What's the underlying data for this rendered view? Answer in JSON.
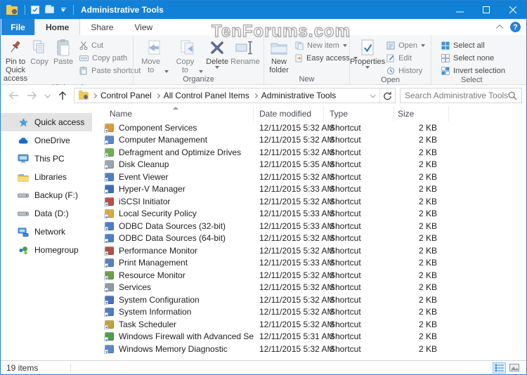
{
  "colors": {
    "titlebar": "#1081d7",
    "accent": "#2a7fd4",
    "file_tab": "#1f83d9",
    "sidebar_selected": "#e3e3e3"
  },
  "window": {
    "title": "Administrative Tools"
  },
  "watermark": "TenForums.com",
  "tabs": {
    "file": "File",
    "home": "Home",
    "share": "Share",
    "view": "View",
    "help_glyph": "?"
  },
  "ribbon": {
    "clipboard": {
      "label": "Clipboard",
      "pin": "Pin to Quick access",
      "copy": "Copy",
      "paste": "Paste",
      "cut": "Cut",
      "copy_path": "Copy path",
      "paste_shortcut": "Paste shortcut"
    },
    "organize": {
      "label": "Organize",
      "move_to": "Move to",
      "copy_to": "Copy to",
      "delete": "Delete",
      "rename": "Rename"
    },
    "new": {
      "label": "New",
      "new_folder": "New folder",
      "new_item": "New item",
      "easy_access": "Easy access"
    },
    "open": {
      "label": "Open",
      "properties": "Properties",
      "open": "Open",
      "edit": "Edit",
      "history": "History"
    },
    "select": {
      "label": "Select",
      "select_all": "Select all",
      "select_none": "Select none",
      "invert": "Invert selection"
    }
  },
  "addressbar": {
    "breadcrumbs": [
      "Control Panel",
      "All Control Panel Items",
      "Administrative Tools"
    ]
  },
  "search": {
    "placeholder": "Search Administrative Tools"
  },
  "sidebar": {
    "items": [
      {
        "label": "Quick access",
        "selected": true
      },
      {
        "label": "OneDrive"
      },
      {
        "label": "This PC"
      },
      {
        "label": "Libraries"
      },
      {
        "label": "Backup (F:)"
      },
      {
        "label": "Data (D:)"
      },
      {
        "label": "Network"
      },
      {
        "label": "Homegroup"
      }
    ]
  },
  "files": {
    "columns": [
      "Name",
      "Date modified",
      "Type",
      "Size"
    ],
    "rows": [
      {
        "name": "Component Services",
        "date": "12/11/2015 5:32 AM",
        "type": "Shortcut",
        "size": "2 KB",
        "color": "#d99a3a"
      },
      {
        "name": "Computer Management",
        "date": "12/11/2015 5:32 AM",
        "type": "Shortcut",
        "size": "2 KB",
        "color": "#5b87c5"
      },
      {
        "name": "Defragment and Optimize Drives",
        "date": "12/11/2015 5:32 AM",
        "type": "Shortcut",
        "size": "2 KB",
        "color": "#6faf4e"
      },
      {
        "name": "Disk Cleanup",
        "date": "12/11/2015 5:35 AM",
        "type": "Shortcut",
        "size": "2 KB",
        "color": "#98a4ae"
      },
      {
        "name": "Event Viewer",
        "date": "12/11/2015 5:32 AM",
        "type": "Shortcut",
        "size": "2 KB",
        "color": "#4c7fc0"
      },
      {
        "name": "Hyper-V Manager",
        "date": "12/11/2015 5:33 AM",
        "type": "Shortcut",
        "size": "2 KB",
        "color": "#3e6db3"
      },
      {
        "name": "iSCSI Initiator",
        "date": "12/11/2015 5:32 AM",
        "type": "Shortcut",
        "size": "2 KB",
        "color": "#b8524a"
      },
      {
        "name": "Local Security Policy",
        "date": "12/11/2015 5:33 AM",
        "type": "Shortcut",
        "size": "2 KB",
        "color": "#d8a93c"
      },
      {
        "name": "ODBC Data Sources (32-bit)",
        "date": "12/11/2015 5:33 AM",
        "type": "Shortcut",
        "size": "2 KB",
        "color": "#4d7ec2"
      },
      {
        "name": "ODBC Data Sources (64-bit)",
        "date": "12/11/2015 5:32 AM",
        "type": "Shortcut",
        "size": "2 KB",
        "color": "#4d7ec2"
      },
      {
        "name": "Performance Monitor",
        "date": "12/11/2015 5:32 AM",
        "type": "Shortcut",
        "size": "2 KB",
        "color": "#b05048"
      },
      {
        "name": "Print Management",
        "date": "12/11/2015 5:33 AM",
        "type": "Shortcut",
        "size": "2 KB",
        "color": "#5a7ec2"
      },
      {
        "name": "Resource Monitor",
        "date": "12/11/2015 5:32 AM",
        "type": "Shortcut",
        "size": "2 KB",
        "color": "#6e9e45"
      },
      {
        "name": "Services",
        "date": "12/11/2015 5:32 AM",
        "type": "Shortcut",
        "size": "2 KB",
        "color": "#8d9aa5"
      },
      {
        "name": "System Configuration",
        "date": "12/11/2015 5:32 AM",
        "type": "Shortcut",
        "size": "2 KB",
        "color": "#4d6fc0"
      },
      {
        "name": "System Information",
        "date": "12/11/2015 5:32 AM",
        "type": "Shortcut",
        "size": "2 KB",
        "color": "#4d7ec2"
      },
      {
        "name": "Task Scheduler",
        "date": "12/11/2015 5:32 AM",
        "type": "Shortcut",
        "size": "2 KB",
        "color": "#c2a23a"
      },
      {
        "name": "Windows Firewall with Advanced Security",
        "date": "12/11/2015 5:31 AM",
        "type": "Shortcut",
        "size": "2 KB",
        "color": "#4b9e4b"
      },
      {
        "name": "Windows Memory Diagnostic",
        "date": "12/11/2015 5:32 AM",
        "type": "Shortcut",
        "size": "2 KB",
        "color": "#5b87c5"
      }
    ]
  },
  "statusbar": {
    "count": "19 items"
  }
}
